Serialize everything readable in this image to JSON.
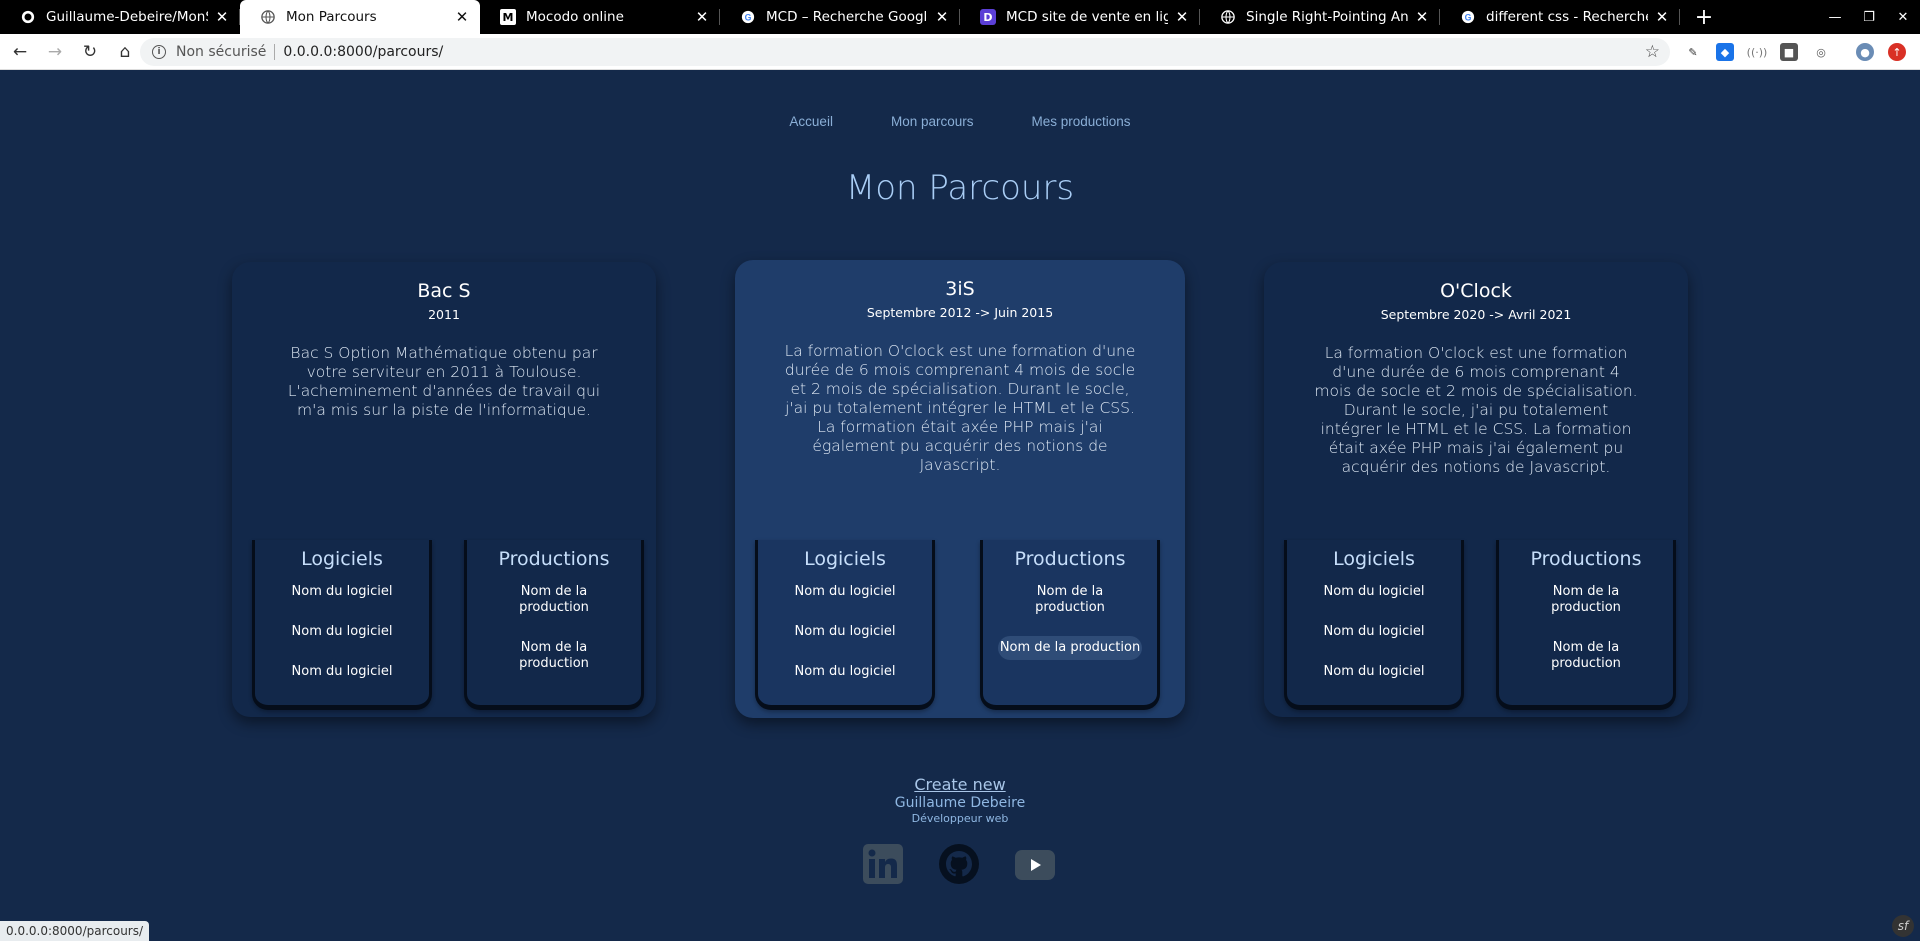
{
  "browser": {
    "tabs": [
      {
        "title": "Guillaume-Debeire/MonSit",
        "icon": "github-icon",
        "active": false
      },
      {
        "title": "Mon Parcours",
        "icon": "globe-icon",
        "active": true
      },
      {
        "title": "Mocodo online",
        "icon": "mocodo-icon",
        "active": false
      },
      {
        "title": "MCD – Recherche Google",
        "icon": "google-icon",
        "active": false
      },
      {
        "title": "MCD site de vente en ligne",
        "icon": "app-icon",
        "active": false
      },
      {
        "title": "Single Right-Pointing Angle",
        "icon": "globe-icon",
        "active": false
      },
      {
        "title": "different css - Recherche G",
        "icon": "google-icon",
        "active": false
      }
    ],
    "security_label": "Non sécurisé",
    "url": "0.0.0.0:8000/parcours/",
    "status_url": "0.0.0.0:8000/parcours/"
  },
  "nav": {
    "items": [
      "Accueil",
      "Mon parcours",
      "Mes productions"
    ]
  },
  "page_title": "Mon Parcours",
  "cards": [
    {
      "title": "Bac S",
      "date": "2011",
      "description": "Bac S Option Mathématique obtenu par votre serviteur en 2011 à Toulouse. L'acheminement d'années de travail qui m'a mis sur la piste de l'informatique.",
      "logiciels_title": "Logiciels",
      "logiciels": [
        "Nom du logiciel",
        "Nom du logiciel",
        "Nom du logiciel"
      ],
      "productions_title": "Productions",
      "productions": [
        "Nom de la production",
        "Nom de la production"
      ]
    },
    {
      "title": "3iS",
      "date": "Septembre 2012 -> Juin 2015",
      "description": "La formation O'clock est une formation d'une durée de 6 mois comprenant 4 mois de socle et 2 mois de spécialisation. Durant le socle, j'ai pu totalement intégrer le HTML et le CSS. La formation était axée PHP mais j'ai également pu acquérir des notions de Javascript.",
      "logiciels_title": "Logiciels",
      "logiciels": [
        "Nom du logiciel",
        "Nom du logiciel",
        "Nom du logiciel"
      ],
      "productions_title": "Productions",
      "productions": [
        "Nom de la production",
        "Nom de la production"
      ]
    },
    {
      "title": "O'Clock",
      "date": "Septembre 2020 -> Avril 2021",
      "description": "La formation O'clock est une formation d'une durée de 6 mois comprenant 4 mois de socle et 2 mois de spécialisation. Durant le socle, j'ai pu totalement intégrer le HTML et le CSS. La formation était axée PHP mais j'ai également pu acquérir des notions de Javascript.",
      "logiciels_title": "Logiciels",
      "logiciels": [
        "Nom du logiciel",
        "Nom du logiciel",
        "Nom du logiciel"
      ],
      "productions_title": "Productions",
      "productions": [
        "Nom de la production",
        "Nom de la production"
      ]
    }
  ],
  "footer": {
    "create_new": "Create new",
    "name": "Guillaume Debeire",
    "job": "Développeur web",
    "social": [
      "linkedin-icon",
      "github-icon",
      "youtube-icon"
    ]
  },
  "colors": {
    "background": "#14294a",
    "card_highlight": "#1f3d6a",
    "title": "#a9cdf5"
  }
}
